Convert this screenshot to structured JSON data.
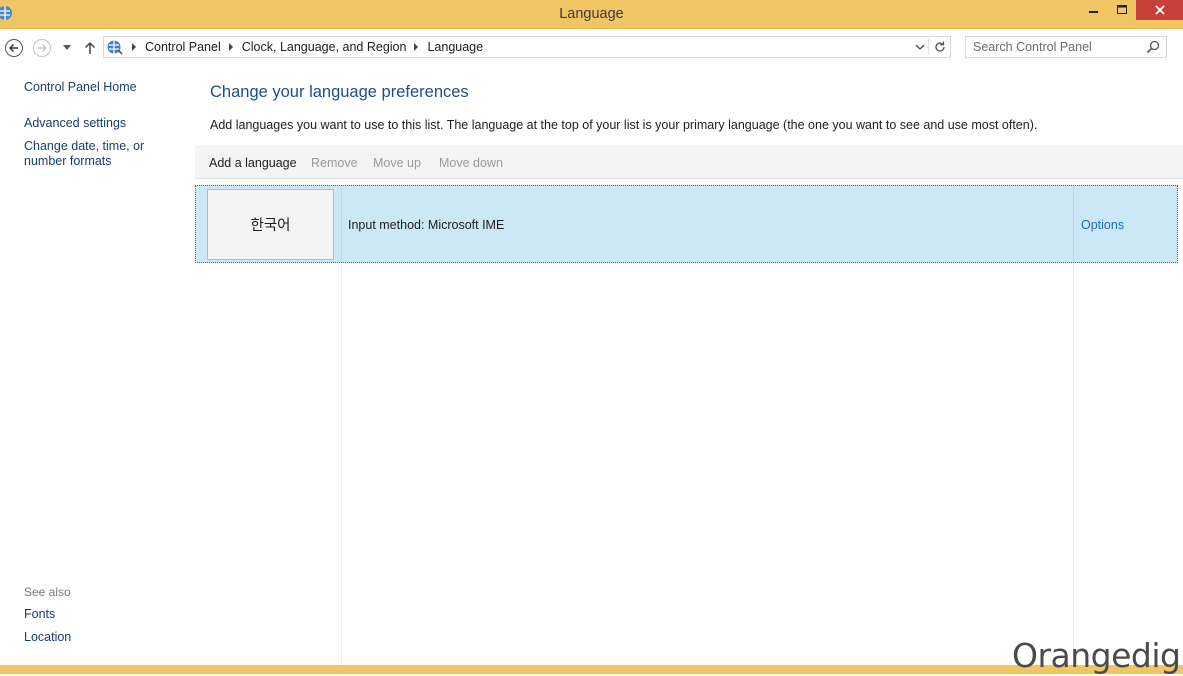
{
  "window": {
    "title": "Language",
    "minimize_glyph": "—",
    "maximize_glyph": "☐",
    "close_glyph": "✕"
  },
  "address_bar": {
    "crumbs": [
      "Control Panel",
      "Clock, Language, and Region",
      "Language"
    ]
  },
  "search": {
    "placeholder": "Search Control Panel",
    "value": ""
  },
  "left_pane": {
    "home": "Control Panel Home",
    "advanced": "Advanced settings",
    "change_date": "Change date, time, or number formats",
    "see_also": "See also",
    "fonts": "Fonts",
    "location": "Location"
  },
  "main": {
    "title": "Change your language preferences",
    "description": "Add languages you want to use to this list. The language at the top of your list is your primary language (the one you want to see and use most often)."
  },
  "toolbar": {
    "add": "Add a language",
    "remove": "Remove",
    "move_up": "Move up",
    "move_down": "Move down"
  },
  "languages": [
    {
      "name": "한국어",
      "input_method": "Input method: Microsoft IME",
      "options": "Options"
    }
  ],
  "watermark": "Orangedigm",
  "colors": {
    "titlebar": "#f2c564",
    "close": "#c7403a",
    "link": "#1a3d6e",
    "heading": "#1e4e8c",
    "selection": "#cce8f6"
  }
}
